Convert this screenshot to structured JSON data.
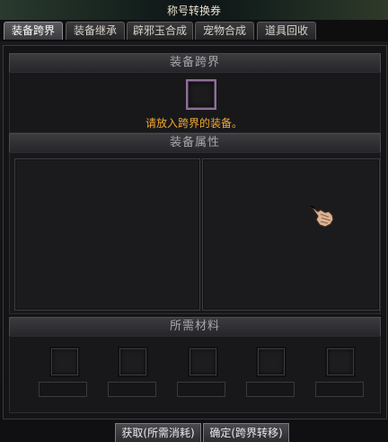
{
  "window": {
    "title": "称号转换券"
  },
  "tabs": [
    {
      "label": "装备跨界",
      "active": true
    },
    {
      "label": "装备继承",
      "active": false
    },
    {
      "label": "辟邪玉合成",
      "active": false
    },
    {
      "label": "宠物合成",
      "active": false
    },
    {
      "label": "道具回收",
      "active": false
    }
  ],
  "cross": {
    "header": "装备跨界",
    "hint": "请放入跨界的装备。"
  },
  "attributes": {
    "header": "装备属性"
  },
  "materials": {
    "header": "所需材料"
  },
  "buttons": {
    "obtain": "获取(所需消耗)",
    "confirm": "确定(跨界转移)"
  },
  "colors": {
    "hint": "#f0a838",
    "slot_border": "#8f6e9a"
  },
  "icons": [
    "hand-cursor-icon"
  ]
}
